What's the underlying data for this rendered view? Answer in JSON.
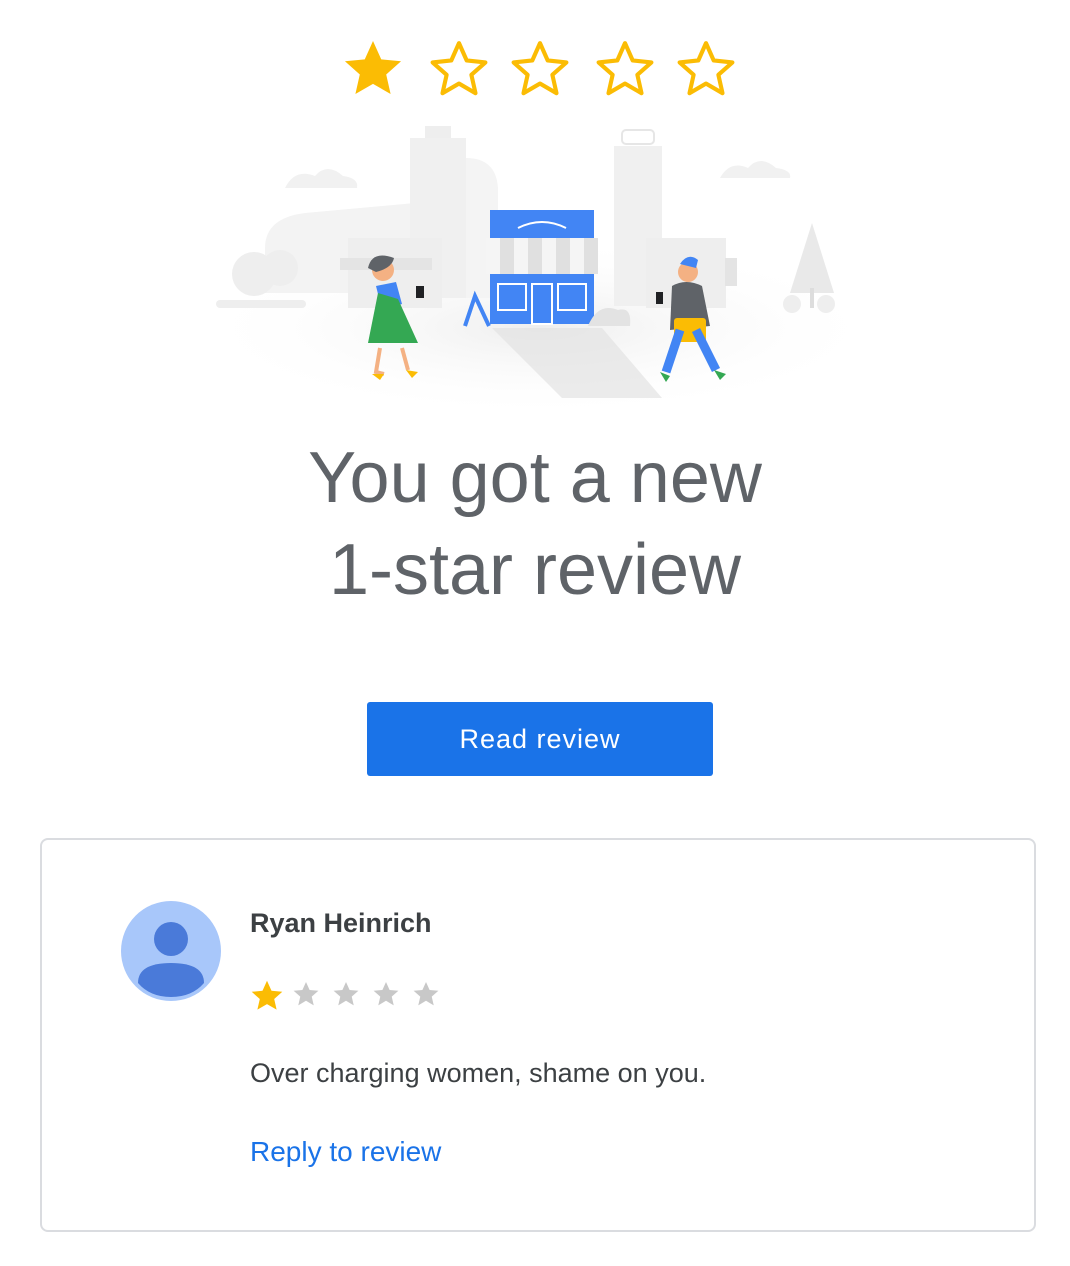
{
  "header": {
    "rating": 1,
    "max_rating": 5
  },
  "headline": {
    "line1": "You got a new",
    "line2": "1-star review"
  },
  "actions": {
    "read_review_label": "Read review"
  },
  "review": {
    "reviewer_name": "Ryan Heinrich",
    "rating": 1,
    "max_rating": 5,
    "text": "Over charging women, shame on you.",
    "reply_label": "Reply to review"
  },
  "colors": {
    "star_filled": "#fbbc04",
    "star_empty_small": "#c8c8c8",
    "primary": "#1a73e8",
    "headline_text": "#5f6368",
    "avatar_bg": "#a8c7fa",
    "avatar_fg": "#4a7ad9"
  },
  "icons": {
    "top_star": "star-icon",
    "avatar": "person-avatar-icon",
    "illustration": "storefront-illustration"
  }
}
